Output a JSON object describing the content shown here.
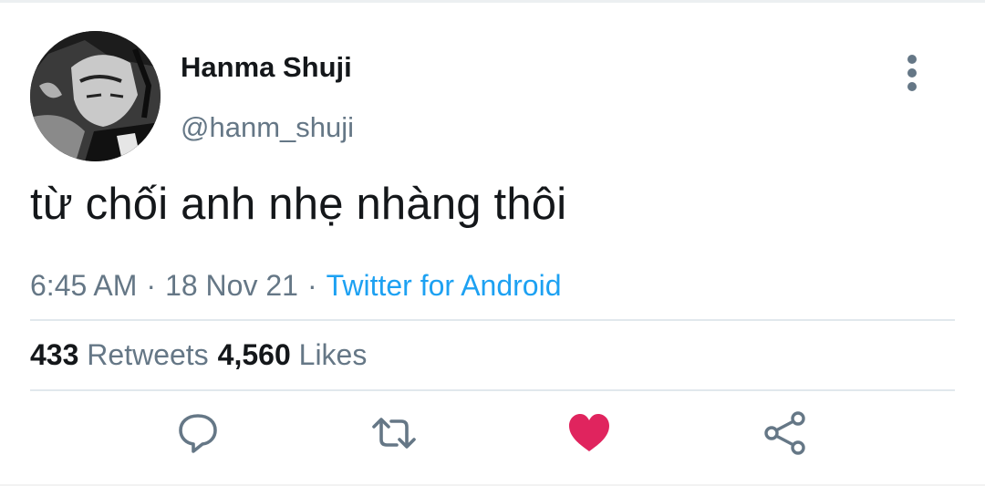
{
  "user": {
    "display_name": "Hanma Shuji",
    "handle": "@hanm_shuji"
  },
  "tweet": {
    "text": "từ chối anh nhẹ nhàng thôi",
    "time": "6:45 AM",
    "date": "18 Nov 21",
    "separator": "·",
    "source": "Twitter for Android"
  },
  "stats": {
    "retweets_count": "433",
    "retweets_label": "Retweets",
    "likes_count": "4,560",
    "likes_label": "Likes"
  },
  "actions": {
    "reply_icon": "reply-icon",
    "retweet_icon": "retweet-icon",
    "like_icon": "heart-icon",
    "share_icon": "share-icon"
  },
  "colors": {
    "name_text": "#14171a",
    "secondary_text": "#657786",
    "link": "#1da1f2",
    "liked_heart": "#e0245e",
    "divider": "#e1e8ed"
  }
}
